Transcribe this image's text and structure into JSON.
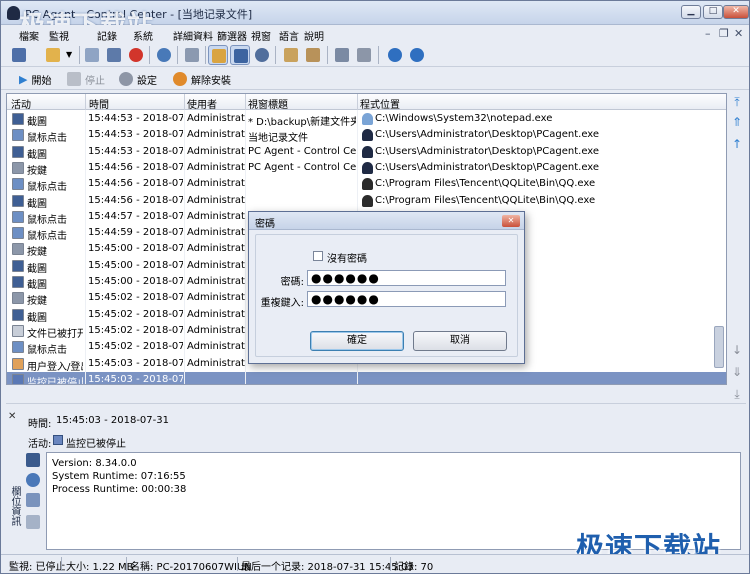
{
  "window": {
    "title": "PC Agent - Control Center - [当地记录文件]",
    "watermark": "极速下载站"
  },
  "menu": [
    "檔案",
    "監視",
    "記錄",
    "系統",
    "詳細資料",
    "篩選器",
    "視窗",
    "語言",
    "說明"
  ],
  "actions": {
    "start": "開始",
    "stop": "停止",
    "settings": "設定",
    "uninstall": "解除安裝"
  },
  "grid": {
    "columns": [
      "活动",
      "時間",
      "使用者",
      "視窗標題",
      "程式位置"
    ],
    "rows": [
      {
        "activity": "截圖",
        "time": "15:44:53 - 2018-07-31",
        "user": "Administrator",
        "window": "* D:\\backup\\新建文件夹\\当",
        "program": "C:\\Windows\\System32\\notepad.exe"
      },
      {
        "activity": "鼠标点击",
        "time": "15:44:53 - 2018-07-31",
        "user": "Administrator",
        "window": "当地记录文件",
        "program": "C:\\Users\\Administrator\\Desktop\\PCagent.exe"
      },
      {
        "activity": "截圖",
        "time": "15:44:53 - 2018-07-31",
        "user": "Administrator",
        "window": "PC Agent - Control Center",
        "program": "C:\\Users\\Administrator\\Desktop\\PCagent.exe"
      },
      {
        "activity": "按鍵",
        "time": "15:44:56 - 2018-07-31",
        "user": "Administrator",
        "window": "PC Agent - Control Center",
        "program": "C:\\Users\\Administrator\\Desktop\\PCagent.exe"
      },
      {
        "activity": "鼠标点击",
        "time": "15:44:56 - 2018-07-31",
        "user": "Administrator",
        "window": "",
        "program": "C:\\Program Files\\Tencent\\QQLite\\Bin\\QQ.exe"
      },
      {
        "activity": "截圖",
        "time": "15:44:56 - 2018-07-31",
        "user": "Administrator",
        "window": "",
        "program": "C:\\Program Files\\Tencent\\QQLite\\Bin\\QQ.exe"
      },
      {
        "activity": "鼠标点击",
        "time": "15:44:57 - 2018-07-31",
        "user": "Administrator",
        "window": "",
        "program": ""
      },
      {
        "activity": "鼠标点击",
        "time": "15:44:59 - 2018-07-31",
        "user": "Administrator",
        "window": "",
        "program": "\\QQ.exe"
      },
      {
        "activity": "按鍵",
        "time": "15:45:00 - 2018-07-31",
        "user": "Administrator",
        "window": "",
        "program": "\\QQ.exe"
      },
      {
        "activity": "截圖",
        "time": "15:45:00 - 2018-07-31",
        "user": "Administrator",
        "window": "",
        "program": "\\QQ.exe"
      },
      {
        "activity": "截圖",
        "time": "15:45:00 - 2018-07-31",
        "user": "Administrator",
        "window": "",
        "program": "\\QQ.exe"
      },
      {
        "activity": "按鍵",
        "time": "15:45:02 - 2018-07-31",
        "user": "Administrator",
        "window": "",
        "program": "\\QQ.exe"
      },
      {
        "activity": "截圖",
        "time": "15:45:02 - 2018-07-31",
        "user": "Administrator",
        "window": "",
        "program": "\\QQ.exe"
      },
      {
        "activity": "文件已被打开",
        "time": "15:45:02 - 2018-07-31",
        "user": "Administrator",
        "window": "",
        "program": ""
      },
      {
        "activity": "鼠标点击",
        "time": "15:45:02 - 2018-07-31",
        "user": "Administrator",
        "window": "",
        "program": "gent.exe"
      },
      {
        "activity": "用户登入/登出",
        "time": "15:45:03 - 2018-07-31",
        "user": "Administrator",
        "window": "",
        "program": ""
      },
      {
        "activity": "监控已被停止",
        "time": "15:45:03 - 2018-07-31",
        "user": "",
        "window": "",
        "program": ""
      }
    ]
  },
  "detail": {
    "time_label": "時間:",
    "time_value": "15:45:03 - 2018-07-31",
    "activity_label": "活动:",
    "activity_value": "监控已被停止",
    "side_label": "欄位資訊",
    "info": {
      "version": "Version: 8.34.0.0",
      "system_runtime": "System Runtime: 07:16:55",
      "process_runtime": "Process Runtime: 00:00:38"
    }
  },
  "status": {
    "monitor": "監視: 已停止",
    "size": "大小: 1.22 MB",
    "name": "名稱: PC-20170607WIUN",
    "last_record": "最后一个记录: 2018-07-31 15:45:03",
    "records": "記錄: 70"
  },
  "dialog": {
    "title": "密碼",
    "no_password_label": "沒有密碼",
    "password_label": "密碼:",
    "password_value": "●●●●●●",
    "repeat_label": "重複鍵入:",
    "repeat_value": "●●●●●●",
    "ok_label": "確定",
    "cancel_label": "取消"
  },
  "colors": {
    "selection": "#7b93c3",
    "dialog_bg": "#e9edf5",
    "accent": "#2f7fd0",
    "watermark": "#1f5fae"
  }
}
